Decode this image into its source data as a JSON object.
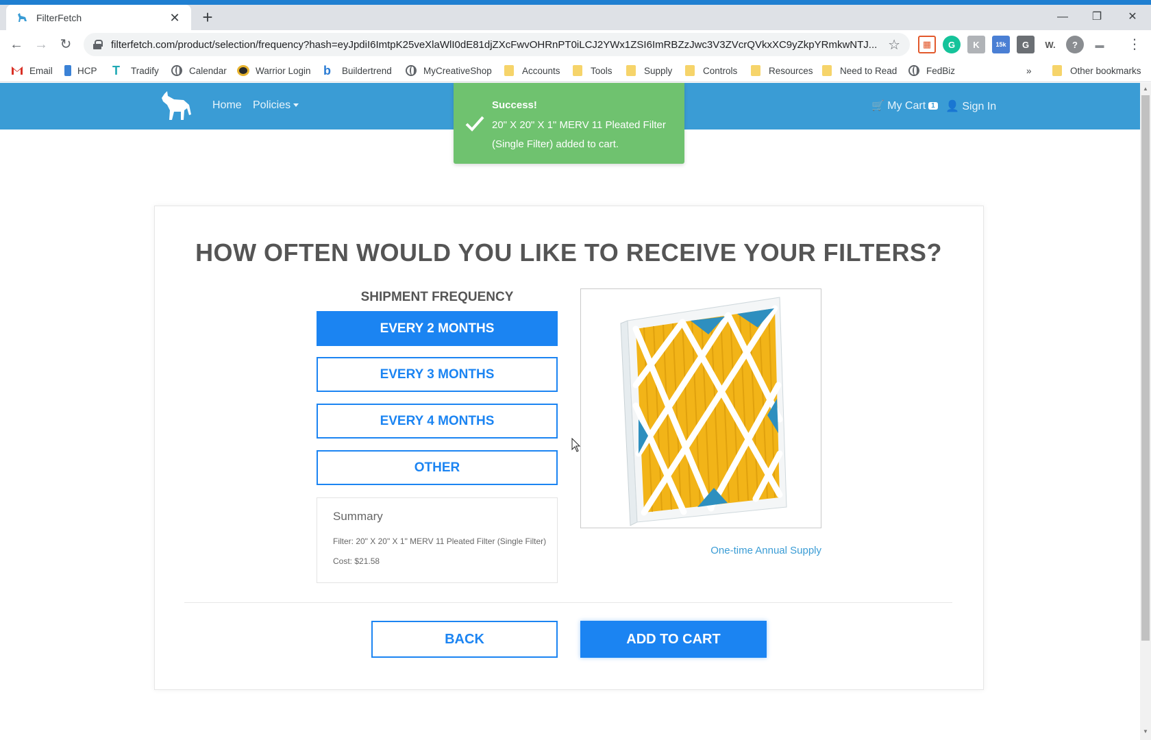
{
  "browser": {
    "tab_title": "FilterFetch",
    "tab_close": "✕",
    "new_tab": "+",
    "url": "filterfetch.com/product/selection/frequency?hash=eyJpdiI6ImtpK25veXlaWlI0dE81djZXcFwvOHRnPT0iLCJ2YWx1ZSI6ImRBZzJwc3V3ZVcrQVkxXC9yZkpYRmkwNTJ...",
    "window_controls": [
      "—",
      "❐",
      "✕"
    ],
    "nav": {
      "back": "←",
      "forward": "→",
      "reload": "↻"
    },
    "extensions": [
      "▦",
      "G",
      "K",
      "15k",
      "G",
      "W.",
      "?"
    ],
    "bookmarks": [
      {
        "label": "Email",
        "icon": "gmail-icon"
      },
      {
        "label": "HCP",
        "icon": "hcp-icon"
      },
      {
        "label": "Tradify",
        "icon": "tradify-icon"
      },
      {
        "label": "Calendar",
        "icon": "globe-icon"
      },
      {
        "label": "Warrior Login",
        "icon": "warrior-icon"
      },
      {
        "label": "Buildertrend",
        "icon": "buildertrend-icon"
      },
      {
        "label": "MyCreativeShop",
        "icon": "globe-icon"
      },
      {
        "label": "Accounts",
        "icon": "folder-icon"
      },
      {
        "label": "Tools",
        "icon": "folder-icon"
      },
      {
        "label": "Supply",
        "icon": "folder-icon"
      },
      {
        "label": "Controls",
        "icon": "folder-icon"
      },
      {
        "label": "Resources",
        "icon": "folder-icon"
      },
      {
        "label": "Need to Read",
        "icon": "folder-icon"
      },
      {
        "label": "FedBiz",
        "icon": "globe-icon"
      }
    ],
    "bookmarks_overflow": "»",
    "other_bookmarks": "Other bookmarks"
  },
  "site_nav": {
    "home": "Home",
    "policies": "Policies",
    "cart": "My Cart",
    "cart_count": "1",
    "sign_in": "Sign In"
  },
  "toast": {
    "title": "Success!",
    "message": "20\" X 20\" X 1\" MERV 11 Pleated Filter (Single Filter) added to cart."
  },
  "main": {
    "heading": "HOW OFTEN WOULD YOU LIKE TO RECEIVE YOUR FILTERS?",
    "frequency_label": "SHIPMENT FREQUENCY",
    "options": [
      "EVERY 2 MONTHS",
      "EVERY 3 MONTHS",
      "EVERY 4 MONTHS",
      "OTHER"
    ],
    "selected_option": "EVERY 2 MONTHS",
    "summary": {
      "title": "Summary",
      "filter": "Filter: 20\" X 20\" X 1\" MERV 11 Pleated Filter (Single Filter)",
      "cost": "Cost: $21.58"
    },
    "annual_link": "One-time Annual Supply",
    "back_button": "BACK",
    "add_to_cart_button": "ADD TO CART"
  },
  "colors": {
    "accent": "#1b84f2",
    "nav_bar": "#3a9cd5",
    "toast": "#6fc26f",
    "filter_pleat": "#f2b418"
  }
}
